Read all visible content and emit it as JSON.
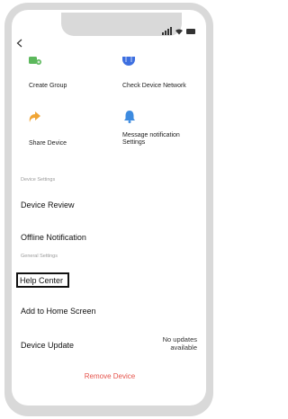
{
  "header": {
    "back_icon": "chevron-left-icon",
    "status_icons": [
      "signal-icon",
      "wifi-icon",
      "battery-icon"
    ]
  },
  "actions": [
    {
      "label": "Create Group",
      "icon": "create-group-icon",
      "color": "#5cb85c"
    },
    {
      "label": "Check Device Network",
      "icon": "globe-icon",
      "color": "#3d6fe0"
    },
    {
      "label": "Share Device",
      "icon": "share-icon",
      "color": "#f0a535"
    },
    {
      "label_line1": "Message notification",
      "label_line2": "Settings",
      "icon": "bell-icon",
      "color": "#3d8be0"
    }
  ],
  "device_settings": {
    "section_label": "Device Settings",
    "device_review": "Device Review",
    "offline_notification": "Offline Notification"
  },
  "general_settings": {
    "section_label": "General Settings",
    "help_center": "Help Center",
    "add_to_home_screen": "Add to Home Screen",
    "device_update": "Device Update",
    "device_update_status_line1": "No updates",
    "device_update_status_line2": "available"
  },
  "footer": {
    "remove_device": "Remove Device",
    "remove_color": "#e5534b"
  }
}
